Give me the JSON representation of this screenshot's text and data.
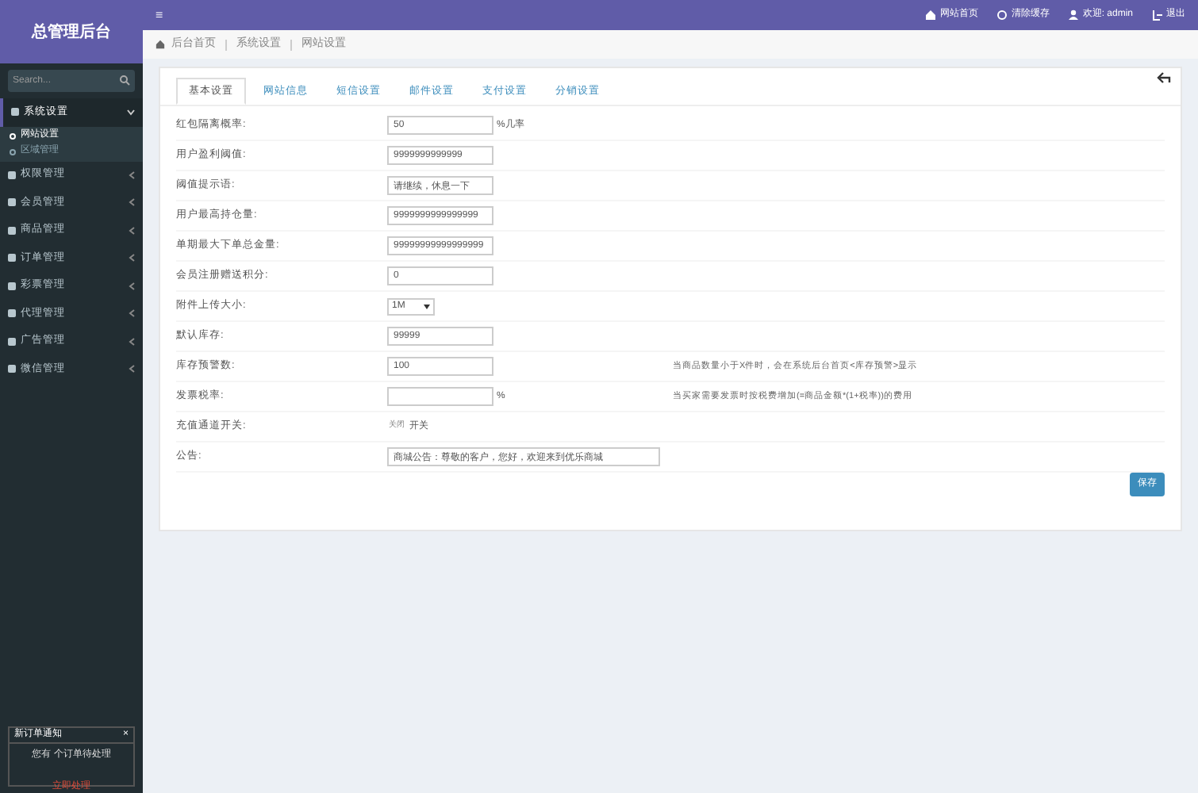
{
  "brand": "总管理后台",
  "sidebar": {
    "search": {
      "placeholder": "Search..."
    },
    "items": [
      {
        "label": "系统设置",
        "expanded": true,
        "children": [
          {
            "label": "网站设置",
            "selected": true
          },
          {
            "label": "区域管理",
            "selected": false
          }
        ]
      },
      {
        "label": "权限管理",
        "expanded": false
      },
      {
        "label": "会员管理",
        "expanded": false
      },
      {
        "label": "商品管理",
        "expanded": false
      },
      {
        "label": "订单管理",
        "expanded": false
      },
      {
        "label": "彩票管理",
        "expanded": false
      },
      {
        "label": "代理管理",
        "expanded": false
      },
      {
        "label": "广告管理",
        "expanded": false
      },
      {
        "label": "微信管理",
        "expanded": false
      }
    ]
  },
  "topbar": {
    "menu_icon": "≡",
    "links": [
      {
        "label": "网站首页"
      },
      {
        "label": "清除缓存"
      },
      {
        "label": "欢迎: admin"
      },
      {
        "label": "退出"
      }
    ]
  },
  "breadcrumb": [
    "后台首页",
    "系统设置",
    "网站设置"
  ],
  "tabs": [
    {
      "label": "基本设置",
      "selected": true
    },
    {
      "label": "网站信息",
      "selected": false
    },
    {
      "label": "短信设置",
      "selected": false
    },
    {
      "label": "邮件设置",
      "selected": false
    },
    {
      "label": "支付设置",
      "selected": false
    },
    {
      "label": "分销设置",
      "selected": false
    }
  ],
  "form": [
    {
      "kind": "input",
      "label": "红包隔离概率:",
      "value": "50",
      "suffix": "%几率"
    },
    {
      "kind": "input",
      "label": "用户盈利阈值:",
      "value": "9999999999999"
    },
    {
      "kind": "input",
      "label": "阈值提示语:",
      "value": "请继续，休息一下"
    },
    {
      "kind": "input",
      "label": "用户最高持仓量:",
      "value": "9999999999999999"
    },
    {
      "kind": "input",
      "label": "单期最大下单总金量:",
      "value": "99999999999999999"
    },
    {
      "kind": "input",
      "label": "会员注册赠送积分:",
      "value": "0"
    },
    {
      "kind": "select",
      "label": "附件上传大小:",
      "value": "1M"
    },
    {
      "kind": "input",
      "label": "默认库存:",
      "value": "99999"
    },
    {
      "kind": "input",
      "label": "库存预警数:",
      "value": "100",
      "help": "当商品数量小于X件时，会在系统后台首页<库存预警>显示"
    },
    {
      "kind": "input",
      "label": "发票税率:",
      "suffix": "%",
      "help": "当买家需要发票时按税费增加(=商品金额*(1+税率))的费用"
    },
    {
      "kind": "toggle",
      "label": "充值通道开关:",
      "on": false,
      "state_label": "关闭",
      "value": "开关"
    },
    {
      "kind": "wide",
      "label": "公告:",
      "value": "商城公告：尊敬的客户，您好，欢迎来到优乐商城"
    }
  ],
  "save_button": "保存",
  "notice": {
    "title": "新订单通知",
    "close": "×",
    "message": "您有 个订单待处理",
    "action": "立即处理"
  }
}
